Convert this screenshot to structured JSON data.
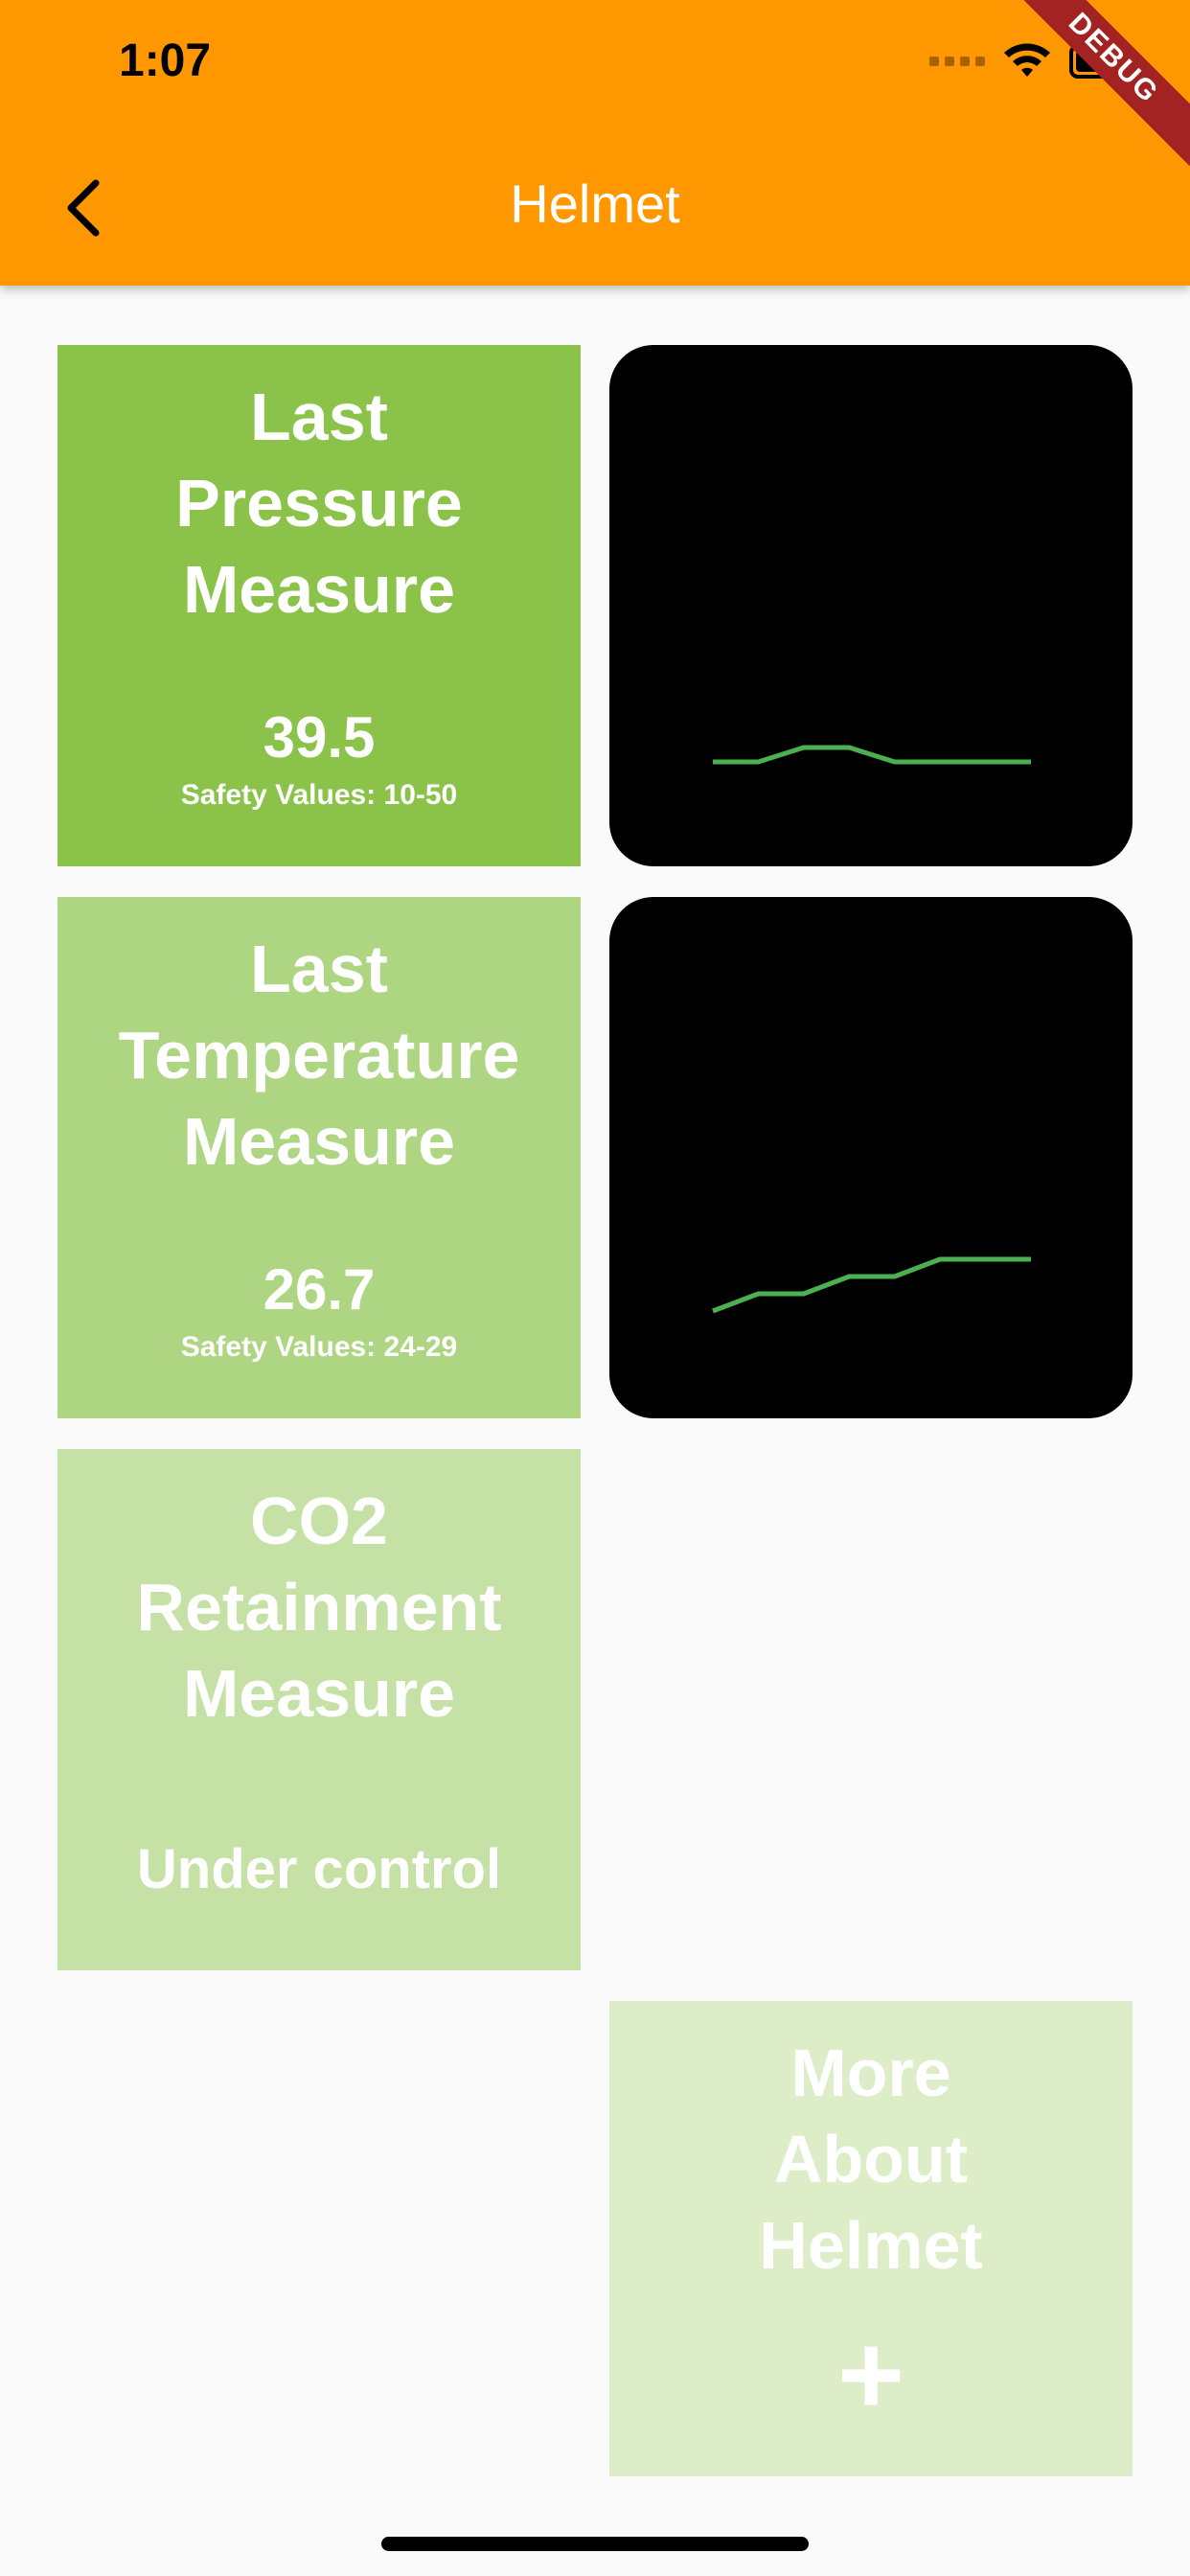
{
  "status_bar": {
    "time": "1:07"
  },
  "debug_banner": "DEBUG",
  "app_bar": {
    "title": "Helmet",
    "back_icon": "chevron-left-icon",
    "color": "#ff9800"
  },
  "tiles": {
    "pressure": {
      "title": "Last Pressure Measure",
      "value": "39.5",
      "safety": "Safety Values: 10-50",
      "color": "#8bc34a"
    },
    "temperature": {
      "title": "Last Temperature Measure",
      "value": "26.7",
      "safety": "Safety Values: 24-29",
      "color": "#aed581"
    },
    "co2": {
      "title": "CO2 Retainment Measure",
      "status": "Under control",
      "color": "#c5e1a5"
    },
    "more": {
      "title": "More About Helmet",
      "icon": "plus-icon",
      "plus": "+",
      "color": "#dcedc8"
    }
  },
  "chart_data": [
    {
      "type": "line",
      "x": [
        0,
        1,
        2,
        3,
        4,
        5,
        6,
        7
      ],
      "values": [
        0,
        0,
        1,
        1,
        0,
        0,
        0,
        0
      ],
      "ylim": [
        0,
        5
      ],
      "line_color": "#4caf50"
    },
    {
      "type": "line",
      "x": [
        0,
        1,
        2,
        3,
        4,
        5,
        6,
        7
      ],
      "values": [
        0,
        1,
        1,
        2,
        2,
        3,
        3,
        3
      ],
      "ylim": [
        -1,
        5
      ],
      "line_color": "#4caf50"
    }
  ]
}
